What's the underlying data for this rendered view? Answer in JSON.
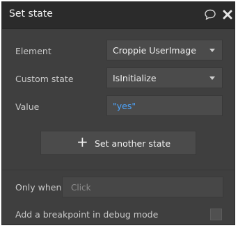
{
  "header": {
    "title": "Set state",
    "icons": [
      "comment-icon",
      "close-icon"
    ]
  },
  "fields": {
    "element_label": "Element",
    "element_value": "Croppie UserImage",
    "custom_state_label": "Custom state",
    "custom_state_value": "IsInitialize",
    "value_label": "Value",
    "value_value": "\"yes\""
  },
  "actions": {
    "set_another_state": "Set another state",
    "plus_glyph": "+"
  },
  "conditions": {
    "only_when_label": "Only when",
    "only_when_placeholder": "Click"
  },
  "debug": {
    "breakpoint_label": "Add a breakpoint in debug mode",
    "breakpoint_checked": false
  },
  "colors": {
    "panel_bg": "#3f3f3f",
    "header_bg": "#2b2b2b",
    "value_accent": "#4da6ff"
  }
}
